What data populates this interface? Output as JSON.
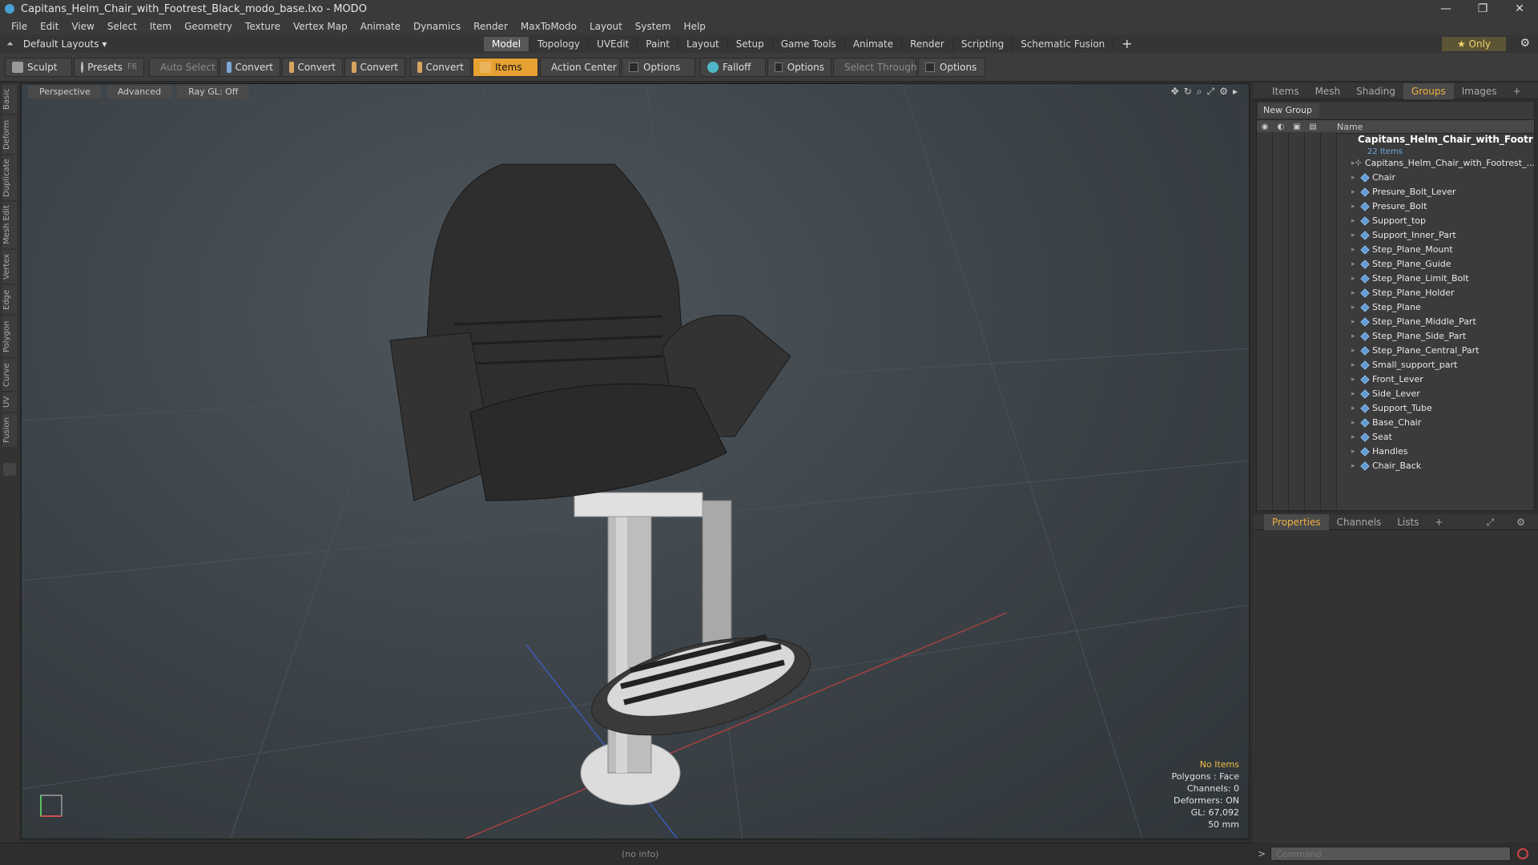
{
  "window": {
    "title": "Capitans_Helm_Chair_with_Footrest_Black_modo_base.lxo - MODO"
  },
  "menu": [
    "File",
    "Edit",
    "View",
    "Select",
    "Item",
    "Geometry",
    "Texture",
    "Vertex Map",
    "Animate",
    "Dynamics",
    "Render",
    "MaxToModo",
    "Layout",
    "System",
    "Help"
  ],
  "layout": {
    "selector": "Default Layouts ▾"
  },
  "tabs": [
    "Model",
    "Topology",
    "UVEdit",
    "Paint",
    "Layout",
    "Setup",
    "Game Tools",
    "Animate",
    "Render",
    "Scripting",
    "Schematic Fusion"
  ],
  "only_label": "★ Only",
  "toolbar": {
    "sculpt": "Sculpt",
    "presets": "Presets",
    "presets_key": "F6",
    "auto_select": "Auto Select",
    "convert": "Convert",
    "items": "Items",
    "action_center": "Action Center",
    "options": "Options",
    "falloff": "Falloff",
    "select_through": "Select Through"
  },
  "left_tabs": [
    "Basic",
    "Deform",
    "Duplicate",
    "Mesh Edit",
    "Vertex",
    "Edge",
    "Polygon",
    "Curve",
    "UV",
    "Fusion"
  ],
  "viewport": {
    "buttons": [
      "Perspective",
      "Advanced",
      "Ray GL: Off"
    ],
    "hud": {
      "no_items": "No Items",
      "polygons": "Polygons : Face",
      "channels": "Channels: 0",
      "deformers": "Deformers: ON",
      "gl": "GL: 67,092",
      "focal": "50 mm"
    }
  },
  "status": {
    "text": "(no info)"
  },
  "right_panel": {
    "tabs": [
      "Items",
      "Mesh ...",
      "Shading",
      "Groups",
      "Images"
    ],
    "active_tab": "Groups",
    "new_group": "New Group",
    "name_col": "Name",
    "root_name": "Capitans_Helm_Chair_with_Footr ...",
    "root_count": "22 Items",
    "items": [
      "Capitans_Helm_Chair_with_Footrest_...",
      "Chair",
      "Presure_Bolt_Lever",
      "Presure_Bolt",
      "Support_top",
      "Support_Inner_Part",
      "Step_Plane_Mount",
      "Step_Plane_Guide",
      "Step_Plane_Limit_Bolt",
      "Step_Plane_Holder",
      "Step_Plane",
      "Step_Plane_Middle_Part",
      "Step_Plane_Side_Part",
      "Step_Plane_Central_Part",
      "Small_support_part",
      "Front_Lever",
      "Side_Lever",
      "Support_Tube",
      "Base_Chair",
      "Seat",
      "Handles",
      "Chair_Back"
    ],
    "props_tabs": [
      "Properties",
      "Channels",
      "Lists"
    ]
  },
  "command": {
    "placeholder": "Command",
    "prompt": ">"
  },
  "colors": {
    "accent": "#e6a132",
    "active_tab_text": "#f0b040",
    "warn": "#f0c040"
  }
}
